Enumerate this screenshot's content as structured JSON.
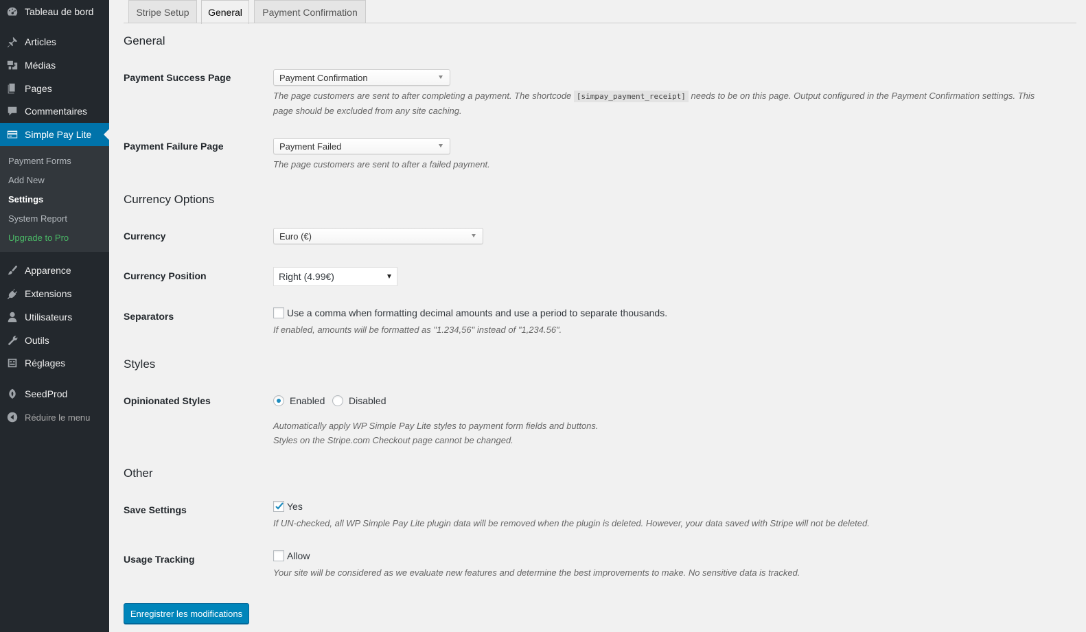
{
  "sidebar": {
    "top_items": [
      {
        "label": "Tableau de bord",
        "icon": "dashboard-icon"
      },
      {
        "label": "Articles",
        "icon": "pin-icon"
      },
      {
        "label": "Médias",
        "icon": "media-icon"
      },
      {
        "label": "Pages",
        "icon": "pages-icon"
      },
      {
        "label": "Commentaires",
        "icon": "comment-icon"
      },
      {
        "label": "Simple Pay Lite",
        "icon": "simplepay-icon"
      }
    ],
    "submenu": [
      {
        "label": "Payment Forms"
      },
      {
        "label": "Add New"
      },
      {
        "label": "Settings"
      },
      {
        "label": "System Report"
      },
      {
        "label": "Upgrade to Pro"
      }
    ],
    "bottom_items": [
      {
        "label": "Apparence",
        "icon": "brush-icon"
      },
      {
        "label": "Extensions",
        "icon": "plugin-icon"
      },
      {
        "label": "Utilisateurs",
        "icon": "user-icon"
      },
      {
        "label": "Outils",
        "icon": "wrench-icon"
      },
      {
        "label": "Réglages",
        "icon": "sliders-icon"
      },
      {
        "label": "SeedProd",
        "icon": "seedprod-icon"
      }
    ],
    "collapse_label": "Réduire le menu",
    "colors": {
      "bg": "#23282d",
      "current": "#0073aa",
      "submenu_bg": "#32373c",
      "upgrade": "#4ab866"
    }
  },
  "tabs": [
    {
      "label": "Stripe Setup",
      "active": false
    },
    {
      "label": "General",
      "active": true
    },
    {
      "label": "Payment Confirmation",
      "active": false
    }
  ],
  "general": {
    "title": "General",
    "success_page": {
      "label": "Payment Success Page",
      "value": "Payment Confirmation",
      "desc_before": "The page customers are sent to after completing a payment. The shortcode",
      "shortcode": "[simpay_payment_receipt]",
      "desc_after": "needs to be on this page. Output configured in the Payment Confirmation settings. This",
      "desc_line2": "page should be excluded from any site caching."
    },
    "failure_page": {
      "label": "Payment Failure Page",
      "value": "Payment Failed",
      "desc": "The page customers are sent to after a failed payment."
    }
  },
  "currency": {
    "title": "Currency Options",
    "currency": {
      "label": "Currency",
      "value": "Euro (€)"
    },
    "position": {
      "label": "Currency Position",
      "value": "Right (4.99€)"
    },
    "separators": {
      "label": "Separators",
      "checkbox_label": "Use a comma when formatting decimal amounts and use a period to separate thousands.",
      "checked": false,
      "desc": "If enabled, amounts will be formatted as \"1.234,56\" instead of \"1,234.56\"."
    }
  },
  "styles": {
    "title": "Styles",
    "opinionated": {
      "label": "Opinionated Styles",
      "option_enabled": "Enabled",
      "option_disabled": "Disabled",
      "selected": "Enabled",
      "desc_line1": "Automatically apply WP Simple Pay Lite styles to payment form fields and buttons.",
      "desc_line2": "Styles on the Stripe.com Checkout page cannot be changed."
    }
  },
  "other": {
    "title": "Other",
    "save_settings": {
      "label": "Save Settings",
      "checkbox_label": "Yes",
      "checked": true,
      "desc": "If UN-checked, all WP Simple Pay Lite plugin data will be removed when the plugin is deleted. However, your data saved with Stripe will not be deleted."
    },
    "usage_tracking": {
      "label": "Usage Tracking",
      "checkbox_label": "Allow",
      "checked": false,
      "desc": "Your site will be considered as we evaluate new features and determine the best improvements to make. No sensitive data is tracked."
    }
  },
  "submit_label": "Enregistrer les modifications"
}
